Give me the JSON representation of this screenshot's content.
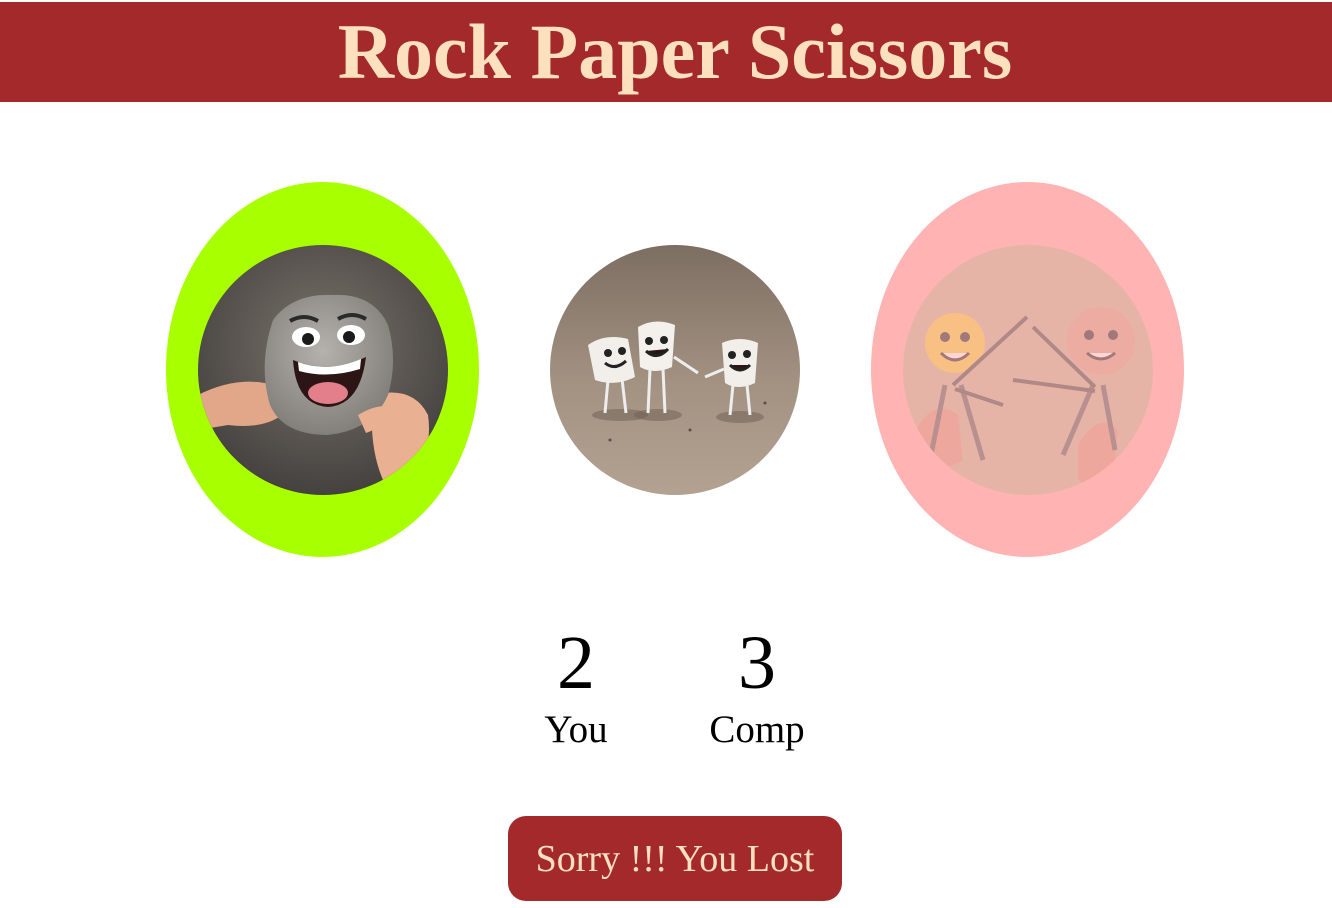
{
  "header": {
    "title": "Rock Paper Scissors"
  },
  "choices": [
    {
      "id": "rock",
      "icon": "rock-face-icon",
      "ring_color": "#a8ff00"
    },
    {
      "id": "paper",
      "icon": "paper-figures-icon",
      "ring_color": ""
    },
    {
      "id": "scissors",
      "icon": "scissors-figures-icon",
      "ring_color": "#ffb3b3"
    }
  ],
  "scoreboard": {
    "user": {
      "score": "2",
      "label": "You"
    },
    "comp": {
      "score": "3",
      "label": "Comp"
    }
  },
  "result": {
    "message": "Sorry !!! You Lost"
  },
  "colors": {
    "header_bg": "#a3292a",
    "header_text": "#fde0bd",
    "win_ring": "#a8ff00",
    "lose_ring": "#ffb3b3"
  }
}
